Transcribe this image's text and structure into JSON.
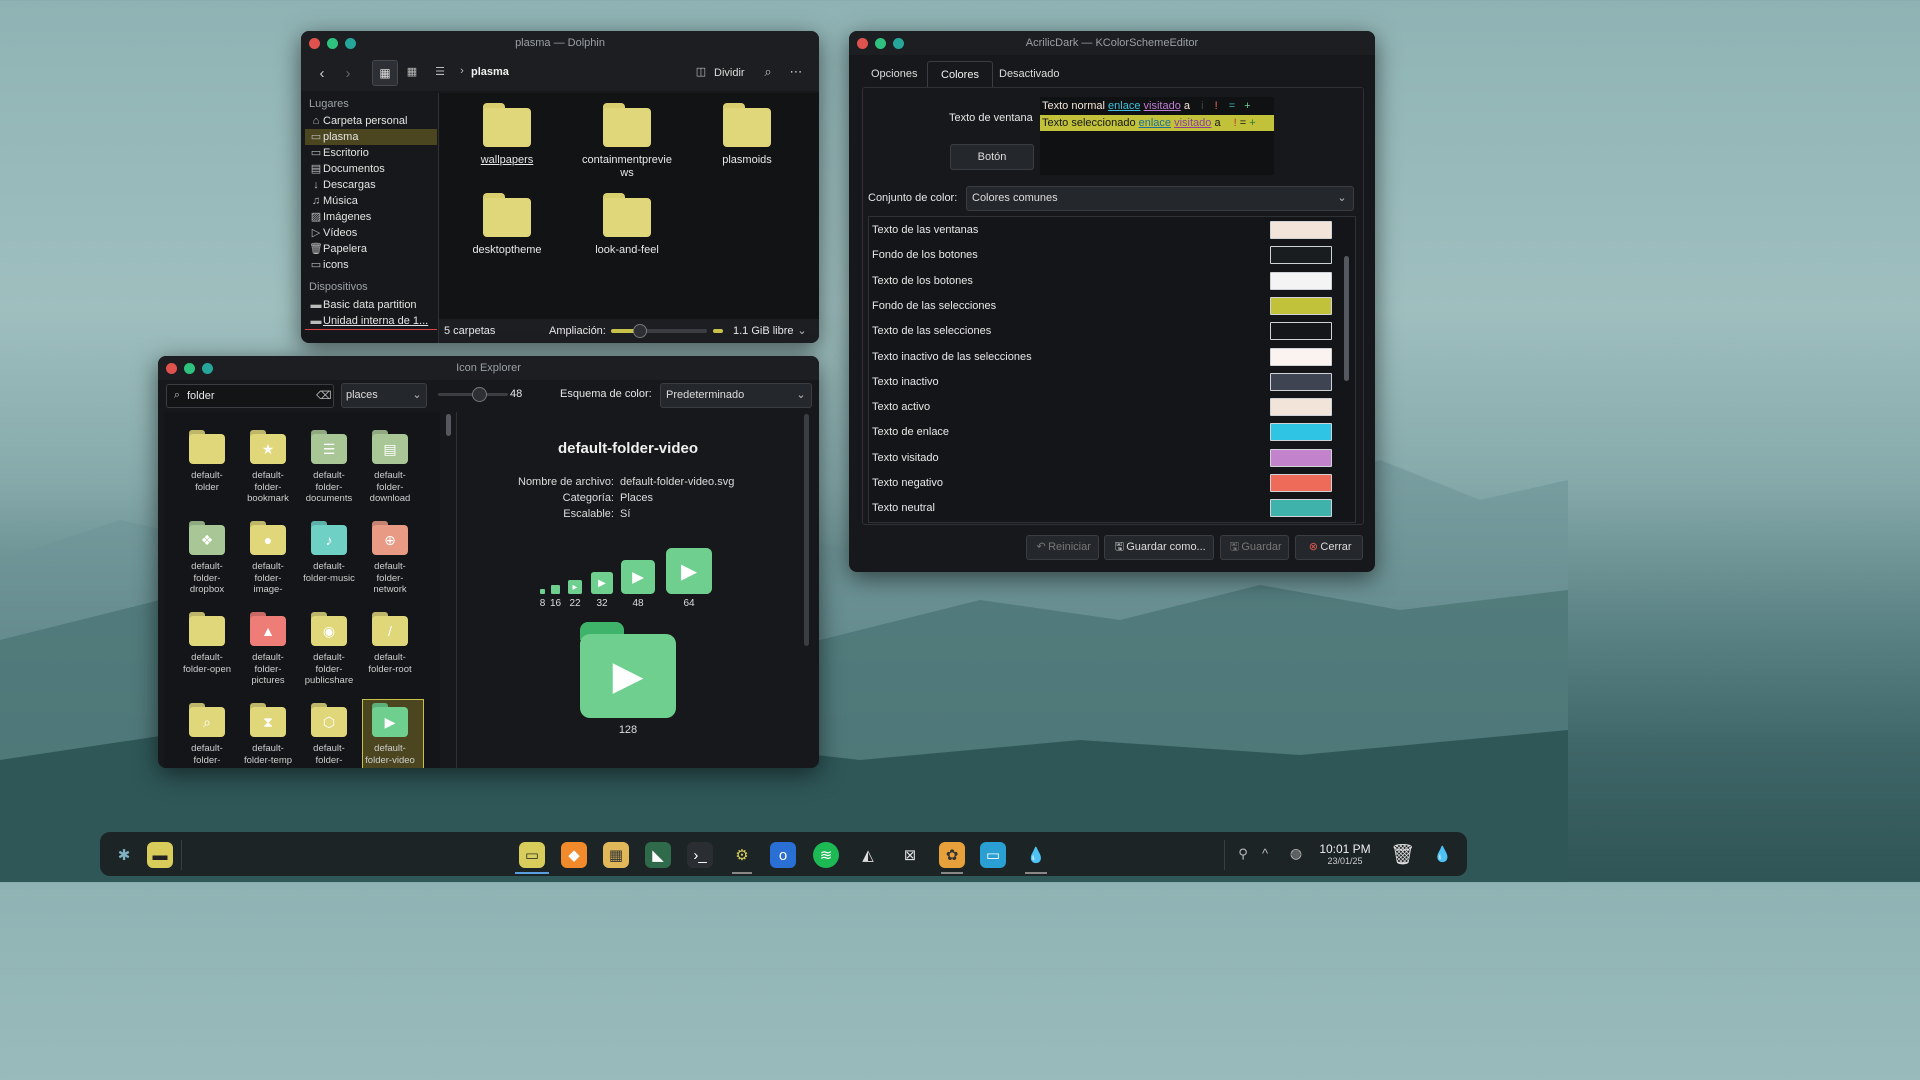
{
  "dolphin": {
    "title": "plasma — Dolphin",
    "breadcrumb": "plasma",
    "split_label": "Dividir",
    "sidebar": {
      "places_header": "Lugares",
      "places": [
        "Carpeta personal",
        "plasma",
        "Escritorio",
        "Documentos",
        "Descargas",
        "Música",
        "Imágenes",
        "Vídeos",
        "Papelera",
        "icons"
      ],
      "devices_header": "Dispositivos",
      "devices": [
        "Basic data partition",
        "Unidad interna de 1..."
      ]
    },
    "folders": [
      "wallpapers",
      "containmentpreviews",
      "plasmoids",
      "desktoptheme",
      "look-and-feel"
    ],
    "folder_labels": {
      "wallpapers": "wallpapers",
      "containment_1": "containmentprevie",
      "containment_2": "ws",
      "plasmoids": "plasmoids",
      "desktoptheme": "desktoptheme",
      "look": "look-and-feel"
    },
    "status_count": "5 carpetas",
    "zoom_label": "Ampliación:",
    "free_space": "1.1 GiB libre"
  },
  "kcolor": {
    "title": "AcrilicDark — KColorSchemeEditor",
    "tabs": [
      "Opciones",
      "Colores",
      "Desactivado"
    ],
    "preview": {
      "window_text_label": "Texto de ventana",
      "normal_text": "Texto normal",
      "selected_text": "Texto seleccionado",
      "link": "enlace",
      "visited": "visitado",
      "a": "a",
      "i": "i",
      "excl": "!",
      "eq": "=",
      "plus": "+",
      "button": "Botón"
    },
    "set_label": "Conjunto de color:",
    "set_value": "Colores comunes",
    "rows": [
      {
        "name": "Texto de las ventanas",
        "color": "#f2e4d8"
      },
      {
        "name": "Fondo de los botones",
        "color": "#1a1d20"
      },
      {
        "name": "Texto de los botones",
        "color": "#f4f4f4"
      },
      {
        "name": "Fondo de las selecciones",
        "color": "#c2c23a"
      },
      {
        "name": "Texto de las selecciones",
        "color": "#14161a"
      },
      {
        "name": "Texto inactivo de las selecciones",
        "color": "#faf3f0"
      },
      {
        "name": "Texto inactivo",
        "color": "#3f4452"
      },
      {
        "name": "Texto activo",
        "color": "#f2e4d8"
      },
      {
        "name": "Texto de enlace",
        "color": "#2fc4e4"
      },
      {
        "name": "Texto visitado",
        "color": "#c383cc"
      },
      {
        "name": "Texto negativo",
        "color": "#ee6b5a"
      },
      {
        "name": "Texto neutral",
        "color": "#3fb2ac"
      }
    ],
    "buttons": {
      "reset": "Reiniciar",
      "save_as": "Guardar como...",
      "save": "Guardar",
      "close": "Cerrar"
    }
  },
  "icon_explorer": {
    "title": "Icon Explorer",
    "search_value": "folder",
    "category": "places",
    "size_value": "48",
    "scheme_label": "Esquema de color:",
    "scheme_value": "Predeterminado",
    "icons": [
      {
        "l1": "default-",
        "l2": "folder",
        "l3": "",
        "color": "#e0d67a",
        "glyph": ""
      },
      {
        "l1": "default-",
        "l2": "folder-",
        "l3": "bookmark",
        "color": "#e0d67a",
        "glyph": "★"
      },
      {
        "l1": "default-",
        "l2": "folder-",
        "l3": "documents",
        "color": "#a9c796",
        "glyph": "☰"
      },
      {
        "l1": "default-",
        "l2": "folder-",
        "l3": "download",
        "color": "#a9c796",
        "glyph": "▤"
      },
      {
        "l1": "default-",
        "l2": "folder-",
        "l3": "dropbox",
        "color": "#a9c796",
        "glyph": "❖"
      },
      {
        "l1": "default-",
        "l2": "folder-",
        "l3": "image-",
        "color": "#e0d67a",
        "glyph": "●"
      },
      {
        "l1": "default-",
        "l2": "folder-music",
        "l3": "",
        "color": "#6fd0c6",
        "glyph": "♪"
      },
      {
        "l1": "default-",
        "l2": "folder-",
        "l3": "network",
        "color": "#e99a85",
        "glyph": "⊕"
      },
      {
        "l1": "default-",
        "l2": "folder-open",
        "l3": "",
        "color": "#e0d67a",
        "glyph": ""
      },
      {
        "l1": "default-",
        "l2": "folder-",
        "l3": "pictures",
        "color": "#ee7d77",
        "glyph": "▲"
      },
      {
        "l1": "default-",
        "l2": "folder-",
        "l3": "publicshare",
        "color": "#e0d67a",
        "glyph": "◉"
      },
      {
        "l1": "default-",
        "l2": "folder-root",
        "l3": "",
        "color": "#e0d67a",
        "glyph": "/"
      },
      {
        "l1": "default-",
        "l2": "folder-",
        "l3": "",
        "color": "#e0d67a",
        "glyph": "⌕"
      },
      {
        "l1": "default-",
        "l2": "folder-temp",
        "l3": "",
        "color": "#e0d67a",
        "glyph": "⧗"
      },
      {
        "l1": "default-",
        "l2": "folder-",
        "l3": "",
        "color": "#e0d67a",
        "glyph": "⬡"
      },
      {
        "l1": "default-",
        "l2": "folder-video",
        "l3": "",
        "color": "#6fcf8f",
        "glyph": "▶"
      }
    ],
    "detail": {
      "name": "default-folder-video",
      "file_label": "Nombre de archivo:",
      "file_value": "default-folder-video.svg",
      "cat_label": "Categoría:",
      "cat_value": "Places",
      "scal_label": "Escalable:",
      "scal_value": "Sí",
      "sizes": [
        "8",
        "16",
        "22",
        "32",
        "48",
        "64"
      ],
      "big_size": "128"
    }
  },
  "taskbar": {
    "time": "10:01 PM",
    "date": "23/01/25"
  }
}
